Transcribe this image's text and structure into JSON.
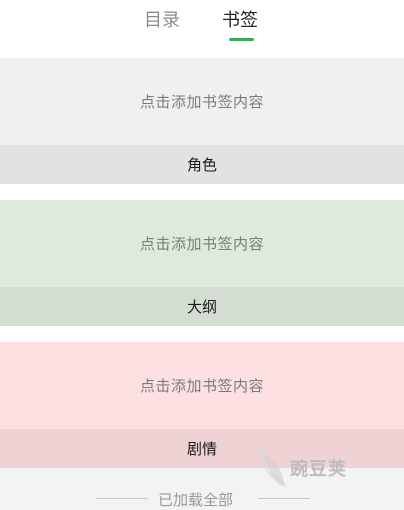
{
  "tabs": {
    "toc_label": "目录",
    "bookmark_label": "书签",
    "active": "书签",
    "accent": "#2db252"
  },
  "bookmark_groups": [
    {
      "placeholder": "点击添加书签内容",
      "title": "角色",
      "body_color": "#f0f0f0",
      "footer_color": "#e2e2e2"
    },
    {
      "placeholder": "点击添加书签内容",
      "title": "大纲",
      "body_color": "#deeadc",
      "footer_color": "#d4ddd2"
    },
    {
      "placeholder": "点击添加书签内容",
      "title": "剧情",
      "body_color": "#fde0e1",
      "footer_color": "#efd2d3"
    }
  ],
  "status": {
    "loaded_all": "已加载全部"
  },
  "watermark": {
    "text": "豌豆荚"
  }
}
